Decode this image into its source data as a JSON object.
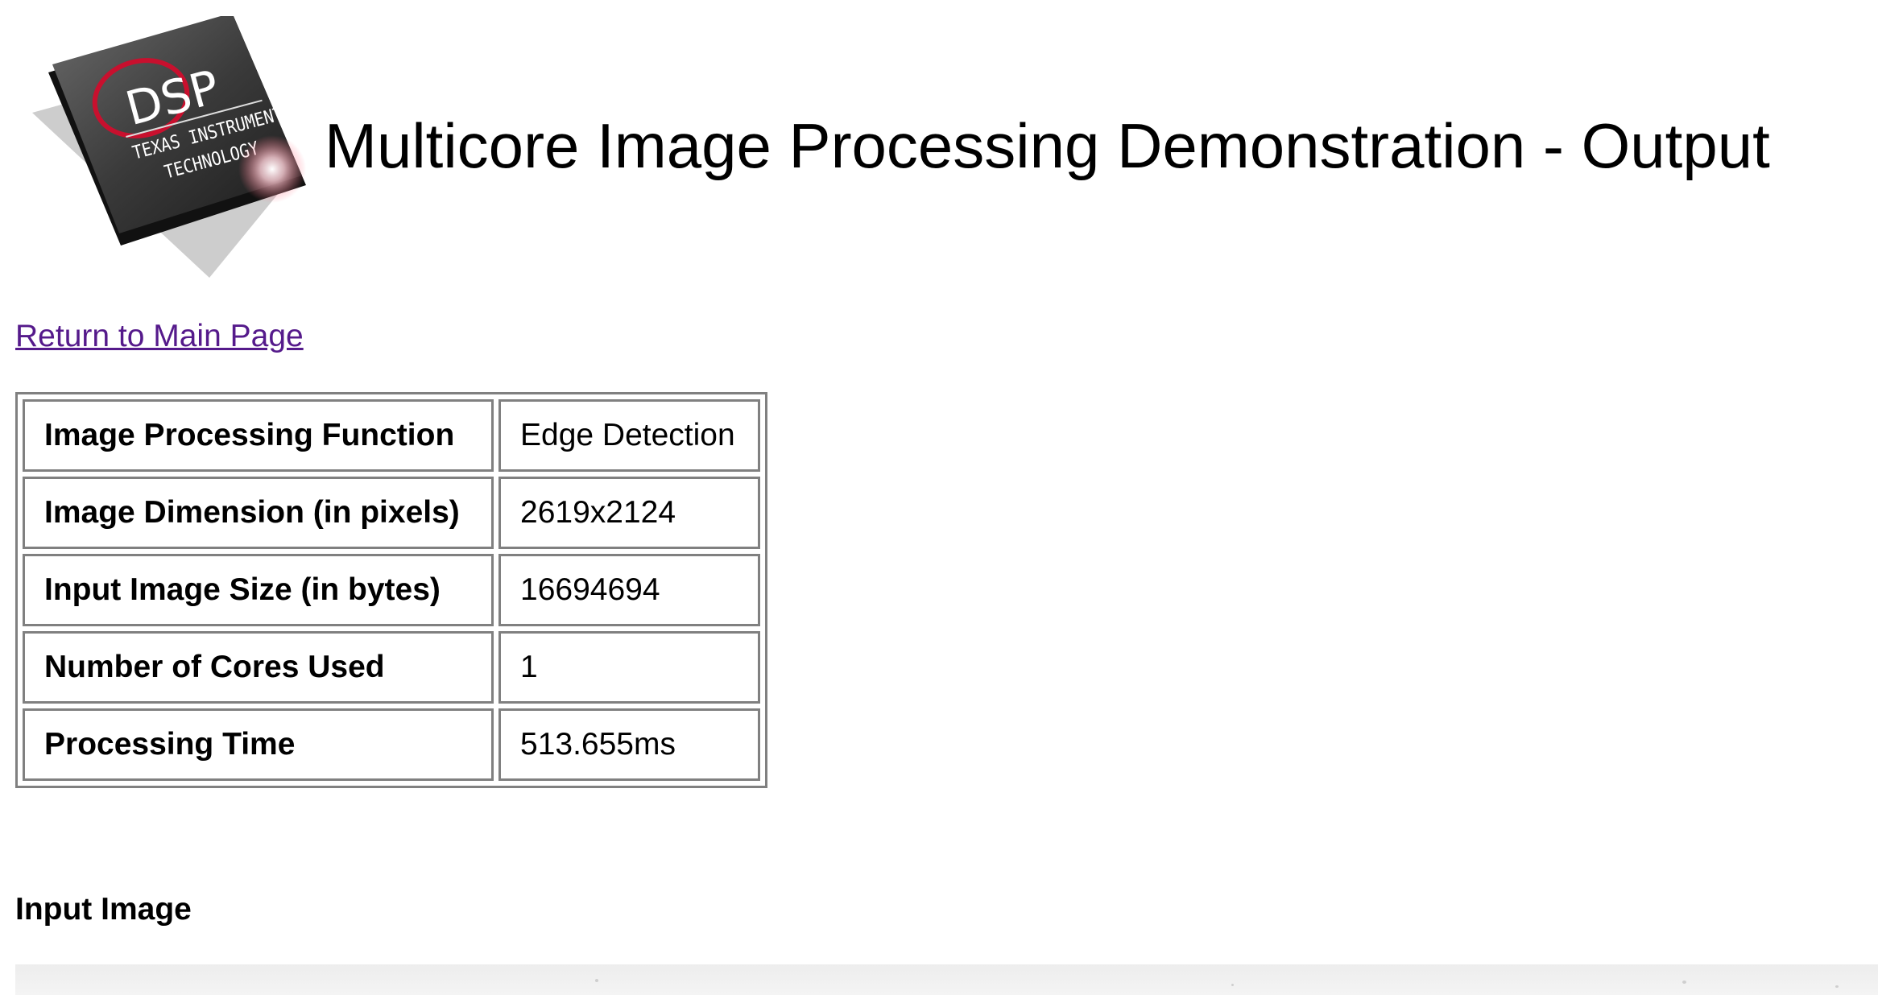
{
  "header": {
    "title": "Multicore Image Processing Demonstration - Output",
    "logo": {
      "main_text": "DSP",
      "sub_text_line1": "TEXAS INSTRUMENTS",
      "sub_text_line2": "TECHNOLOGY",
      "icon": "dsp-chip-logo"
    }
  },
  "nav": {
    "return_link_label": "Return to Main Page"
  },
  "info_table": {
    "rows": [
      {
        "label": "Image Processing Function",
        "value": "Edge Detection"
      },
      {
        "label": "Image Dimension (in pixels)",
        "value": "2619x2124"
      },
      {
        "label": "Input Image Size (in bytes)",
        "value": "16694694"
      },
      {
        "label": "Number of Cores Used",
        "value": "1"
      },
      {
        "label": "Processing Time",
        "value": "513.655ms"
      }
    ]
  },
  "input_section": {
    "heading": "Input Image"
  },
  "colors": {
    "link_visited": "#551a8b",
    "table_border": "#808080",
    "logo_ring": "#c8102e",
    "chip_body": "#3a3a3a"
  }
}
